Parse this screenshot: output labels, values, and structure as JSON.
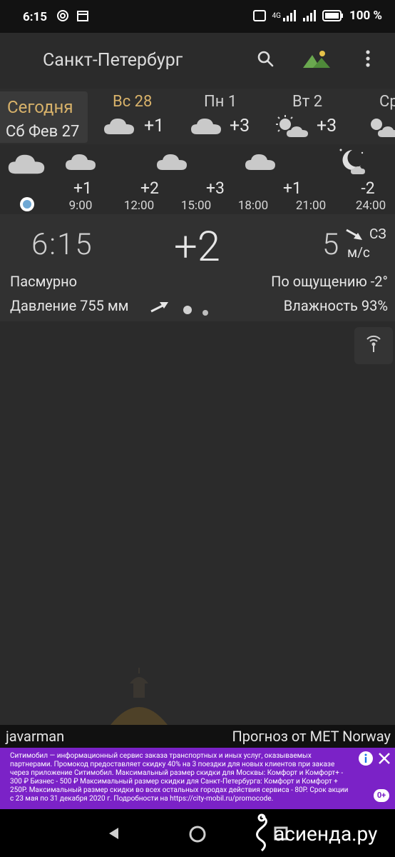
{
  "status_bar": {
    "time": "6:15",
    "battery_text": "100 %",
    "network": "4G"
  },
  "app_bar": {
    "city": "Санкт-Петербург"
  },
  "days": [
    {
      "label": "Сегодня",
      "date": "Сб Фев 27",
      "selected": true
    },
    {
      "name": "Вс 28",
      "temp": "+1",
      "icon": "cloud-icon"
    },
    {
      "name": "Пн 1",
      "temp": "+3",
      "icon": "cloud-icon"
    },
    {
      "name": "Вт 2",
      "temp": "+3",
      "icon": "sun-cloud-icon"
    },
    {
      "name": "Ср",
      "temp": "",
      "icon": "sun-cloud-icon"
    }
  ],
  "hourly": [
    {
      "time": "",
      "temp": "",
      "icon": "cloud-icon"
    },
    {
      "time": "9:00",
      "temp": "+1",
      "icon": "cloud-icon"
    },
    {
      "time": "12:00",
      "temp": "+2",
      "icon": "cloud-icon"
    },
    {
      "time": "15:00",
      "temp": "+3",
      "icon": "cloud-icon"
    },
    {
      "time": "18:00",
      "temp": "",
      "icon": "cloud-icon"
    },
    {
      "time": "21:00",
      "temp": "+1",
      "icon": "cloud-icon"
    },
    {
      "time": "24:00",
      "temp": "-2",
      "icon": "moon-cloud-icon"
    }
  ],
  "current": {
    "time": "6:15",
    "temp": "+2",
    "wind_speed": "5",
    "wind_dir": "СЗ",
    "wind_unit": "м/с",
    "condition": "Пасмурно",
    "feels_like": "По ощущению -2°",
    "pressure": "Давление 755 мм",
    "humidity": "Влажность 93%"
  },
  "footer": {
    "left": "javarman",
    "right": "Прогноз от MET Norway"
  },
  "ad": {
    "text": "Ситимобил — информационный сервис заказа транспортных и иных услуг, оказываемых партнерами. Промокод предоставляет скидку 40% на 3 поездки для новых клиентов при заказе через приложение Ситимобил. Максимальный размер скидки для Москвы: Комфорт и Комфорт+ - 300 ₽ Бизнес - 500 ₽ Максимальный размер скидки для Санкт-Петербурга: Комфорт и Комфорт + 250Р. Максимальный размер скидки во всех остальных городах действия сервиса - 80Р. Срок акции с 23 мая по 31 декабря 2020 г. Подробности на https://city-mobil.ru/promocode.",
    "badge": "0+"
  },
  "watermark": "асиенда.ру",
  "colors": {
    "accent_gold": "#d8b26a",
    "background": "#2b2b2b",
    "ad_purple": "#7b22c7"
  }
}
